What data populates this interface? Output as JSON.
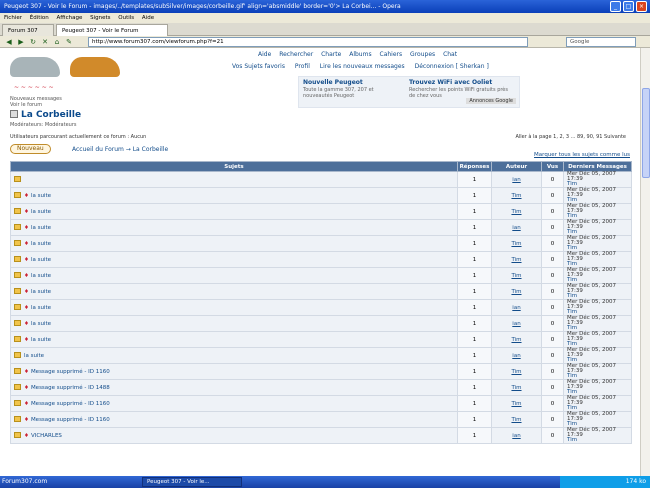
{
  "window": {
    "title": "Peugeot 307 - Voir le Forum - images/../templates/subSilver/images/corbeille.gif' align='absmiddle' border='0'> La Corbei... - Opera"
  },
  "menu": [
    "Fichier",
    "Édition",
    "Affichage",
    "Signets",
    "Outils",
    "Aide"
  ],
  "tabs": [
    "Forum 307",
    "Peugeot 307 - Voir le Forum"
  ],
  "toolbar": {
    "address": "http://www.forum307.com/viewforum.php?f=21",
    "search_placeholder": "Google"
  },
  "forum": {
    "nav": [
      "Aide",
      "Rechercher",
      "Charte",
      "Albums",
      "Cahiers",
      "Groupes",
      "Chat"
    ],
    "nav2": [
      "Vos Sujets favoris",
      "Profil",
      "Lire les nouveaux messages",
      "Déconnexion [ Sherkan ]"
    ],
    "ad_left_title": "Nouvelle Peugeot",
    "ad_left_text": "Toute la gamme 307, 207 et nouveautés Peugeot",
    "ad_right_title": "Trouvez WiFi avec Ooliet",
    "ad_right_text": "Rechercher les points WiFi gratuits près de chez vous",
    "ad_badge": "Annonces Google",
    "smalltext1": "Nouveaux messages",
    "smalltext2": "Voir le forum",
    "title": "La Corbeille",
    "moderators": "Modérateurs: Modérateurs",
    "info": "Utilisateurs parcourant actuellement ce forum : Aucun",
    "pages": "Aller à la page 1, 2, 3 ... 89, 90, 91 Suivante",
    "new_topic": "Nouveau",
    "breadcrumb": "Accueil du Forum → La Corbeille",
    "mark_read": "Marquer tous les sujets comme lus"
  },
  "table": {
    "headers": [
      "Sujets",
      "Réponses",
      "Auteur",
      "Vus",
      "Derniers Messages"
    ],
    "rows": [
      {
        "topic": "",
        "pin": false,
        "replies": "1",
        "author": "ian",
        "views": "0"
      },
      {
        "topic": "la suite",
        "pin": true,
        "replies": "1",
        "author": "Tim",
        "views": "0"
      },
      {
        "topic": "la suite",
        "pin": true,
        "replies": "1",
        "author": "Tim",
        "views": "0"
      },
      {
        "topic": "la suite",
        "pin": true,
        "replies": "1",
        "author": "ian",
        "views": "0"
      },
      {
        "topic": "la suite",
        "pin": true,
        "replies": "1",
        "author": "Tim",
        "views": "0"
      },
      {
        "topic": "la suite",
        "pin": true,
        "replies": "1",
        "author": "Tim",
        "views": "0"
      },
      {
        "topic": "la suite",
        "pin": true,
        "replies": "1",
        "author": "Tim",
        "views": "0"
      },
      {
        "topic": "la suite",
        "pin": true,
        "replies": "1",
        "author": "Tim",
        "views": "0"
      },
      {
        "topic": "la suite",
        "pin": true,
        "replies": "1",
        "author": "ian",
        "views": "0"
      },
      {
        "topic": "la suite",
        "pin": true,
        "replies": "1",
        "author": "ian",
        "views": "0"
      },
      {
        "topic": "la suite",
        "pin": true,
        "replies": "1",
        "author": "Tim",
        "views": "0"
      },
      {
        "topic": "la suite",
        "pin": false,
        "replies": "1",
        "author": "ian",
        "views": "0"
      },
      {
        "topic": "Message supprimé - ID 1160",
        "pin": true,
        "replies": "1",
        "author": "Tim",
        "views": "0"
      },
      {
        "topic": "Message supprimé - ID 1488",
        "pin": true,
        "replies": "1",
        "author": "Tim",
        "views": "0"
      },
      {
        "topic": "Message supprimé - ID 1160",
        "pin": true,
        "replies": "1",
        "author": "Tim",
        "views": "0"
      },
      {
        "topic": "Message supprimé - ID 1160",
        "pin": true,
        "replies": "1",
        "author": "Tim",
        "views": "0"
      },
      {
        "topic": "VICHARLES",
        "pin": true,
        "replies": "1",
        "author": "ian",
        "views": "0"
      }
    ],
    "last_post": "Mer Déc 05, 2007 17:39",
    "last_user": "Tim"
  },
  "taskbar": {
    "start": "démarrer",
    "forum_label": "Forum307.com",
    "task": "Peugeot 307 - Voir le...",
    "tray": "174 ko"
  }
}
